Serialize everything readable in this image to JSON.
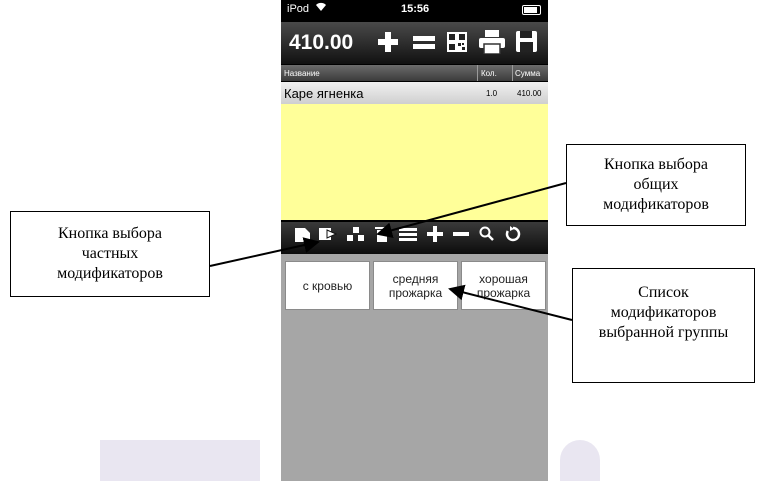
{
  "status_bar": {
    "carrier": "iPod",
    "time": "15:56"
  },
  "toolbar": {
    "total": "410.00",
    "icons": [
      "plus-icon",
      "equals-icon",
      "qr-code-icon",
      "printer-icon",
      "save-icon"
    ]
  },
  "table": {
    "headers": [
      "Название",
      "Кол.",
      "Сумма"
    ],
    "rows": [
      {
        "name": "Каре ягненка",
        "qty": "1.0",
        "sum": "410.00"
      }
    ]
  },
  "action_bar": {
    "icons": [
      "document-icon",
      "private-modifiers-icon",
      "common-modifiers-icon",
      "trash-icon",
      "list-icon",
      "plus-icon",
      "minus-icon",
      "search-icon",
      "refresh-icon"
    ]
  },
  "modifiers": [
    "с кровью",
    "средняя прожарка",
    "хорошая прожарка"
  ],
  "callouts": {
    "common": "Кнопка выбора общих модификаторов",
    "private": "Кнопка выбора частных модификаторов",
    "list": "Список модификаторов выбранной группы"
  },
  "colors": {
    "order_area": "#ffff99",
    "modifier_area": "#a6a6a6",
    "watermark": "#e9e6f1"
  }
}
